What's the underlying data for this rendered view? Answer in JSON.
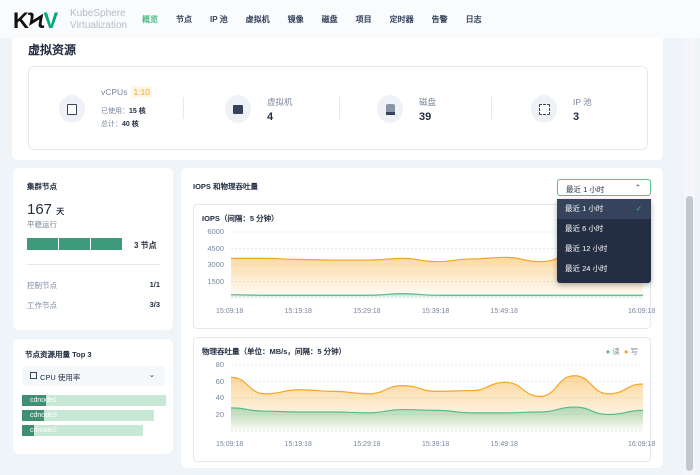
{
  "header": {
    "logo": "KSV",
    "brand_line1": "KubeSphere",
    "brand_line2": "Virtualization",
    "nav": [
      "概览",
      "节点",
      "IP 池",
      "虚拟机",
      "镜像",
      "磁盘",
      "项目",
      "定时器",
      "告警",
      "日志"
    ],
    "active_nav": "概览"
  },
  "virtual_resources": {
    "title": "虚拟资源",
    "vcpu": {
      "label": "vCPUs",
      "ratio": "1:10",
      "used_label": "已使用：",
      "used": "15 核",
      "total_label": "总计：",
      "total": "40 核",
      "icon": "cpu-icon"
    },
    "vm": {
      "label": "虚拟机",
      "value": "4",
      "icon": "laptop-icon"
    },
    "disk": {
      "label": "磁盘",
      "value": "39",
      "icon": "disk-icon"
    },
    "ippool": {
      "label": "IP 池",
      "value": "3",
      "icon": "ip-pool-icon"
    }
  },
  "cluster_nodes": {
    "title": "集群节点",
    "uptime": "167",
    "uptime_unit": "天",
    "uptime_label": "平稳运行",
    "node_count": "3 节点",
    "control_label": "控制节点",
    "control_value": "1/1",
    "worker_label": "工作节点",
    "worker_value": "3/3"
  },
  "top_usage": {
    "title": "节点资源用量 Top 3",
    "metric": "CPU 使用率",
    "nodes": [
      {
        "name": "cdnode1",
        "fraction": 0.17,
        "track": 1.0
      },
      {
        "name": "cdnode3",
        "fraction": 0.15,
        "track": 0.92
      },
      {
        "name": "cdnode2",
        "fraction": 0.08,
        "track": 0.84
      }
    ]
  },
  "io": {
    "title": "IOPS 和物理吞吐量",
    "range": "最近 1 小时",
    "range_options": [
      "最近 1 小时",
      "最近 6 小时",
      "最近 12 小时",
      "最近 24 小时"
    ],
    "selected": 0
  },
  "colors": {
    "accent": "#55bc8a",
    "read": "#55bc8a",
    "write": "#f5a623",
    "dark": "#242e42"
  },
  "chart_data": [
    {
      "type": "area",
      "title": "IOPS（间隔：5 分钟）",
      "ylim": [
        0,
        6000
      ],
      "yticks": [
        "6000",
        "4500",
        "3000",
        "1500"
      ],
      "x": [
        "15:09:18",
        "15:14:18",
        "15:19:18",
        "15:24:18",
        "15:29:18",
        "15:34:18",
        "15:39:18",
        "15:44:18",
        "15:49:18",
        "15:54:18",
        "15:59:18",
        "16:04:18",
        "16:09:18"
      ],
      "xticks": [
        "15:09:18",
        "15:19:18",
        "15:29:18",
        "15:39:18",
        "15:49:18",
        "16:09:18"
      ],
      "series": [
        {
          "name": "写",
          "values": [
            3600,
            3600,
            3500,
            3450,
            3450,
            3600,
            3300,
            3550,
            3700,
            3300,
            3900,
            3700,
            3600
          ]
        },
        {
          "name": "读",
          "values": [
            300,
            250,
            250,
            250,
            250,
            400,
            250,
            250,
            250,
            250,
            250,
            250,
            250
          ]
        }
      ]
    },
    {
      "type": "area",
      "title": "物理吞吐量（单位：MB/s，间隔：5 分钟）",
      "ylim": [
        0,
        80
      ],
      "yticks": [
        "80",
        "60",
        "40",
        "20"
      ],
      "x": [
        "15:09:18",
        "15:14:18",
        "15:19:18",
        "15:24:18",
        "15:29:18",
        "15:34:18",
        "15:39:18",
        "15:44:18",
        "15:49:18",
        "15:54:18",
        "15:59:18",
        "16:04:18",
        "16:09:18"
      ],
      "xticks": [
        "15:09:18",
        "15:19:18",
        "15:29:18",
        "15:39:18",
        "15:49:18",
        "16:09:18"
      ],
      "legend": [
        "读",
        "写"
      ],
      "series": [
        {
          "name": "写",
          "values": [
            65,
            45,
            50,
            48,
            45,
            55,
            48,
            49,
            59,
            42,
            67,
            45,
            57
          ]
        },
        {
          "name": "读",
          "values": [
            28,
            24,
            23,
            23,
            22,
            26,
            25,
            22,
            22,
            23,
            29,
            20,
            25
          ]
        }
      ]
    }
  ]
}
